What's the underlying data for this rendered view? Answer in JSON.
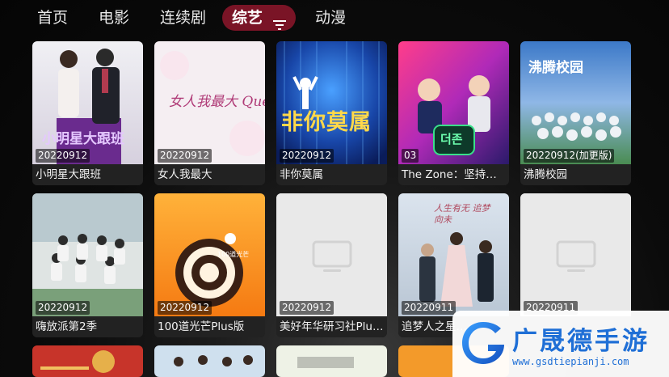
{
  "nav": {
    "tabs": [
      {
        "label": "首页",
        "active": false
      },
      {
        "label": "电影",
        "active": false
      },
      {
        "label": "连续剧",
        "active": false
      },
      {
        "label": "综艺",
        "active": true
      },
      {
        "label": "动漫",
        "active": false
      }
    ]
  },
  "cards": [
    {
      "badge": "20220912",
      "title": "小明星大跟班",
      "poster_text": "小明星大跟班"
    },
    {
      "badge": "20220912",
      "title": "女人我最大",
      "poster_text": "女人我最大 Queen"
    },
    {
      "badge": "20220912",
      "title": "非你莫属",
      "poster_text": "非你莫属"
    },
    {
      "badge": "03",
      "title": "The Zone：坚持才…",
      "poster_text": "더존"
    },
    {
      "badge": "20220912(加更版)",
      "title": "沸腾校园",
      "poster_text": "沸腾校园"
    },
    {
      "badge": "20220912",
      "title": "嗨放派第2季",
      "poster_text": ""
    },
    {
      "badge": "20220912",
      "title": "100道光芒Plus版",
      "poster_text": "100道光芒"
    },
    {
      "badge": "20220912",
      "title": "美好年华研习社Plu…",
      "poster_text": ""
    },
    {
      "badge": "20220911",
      "title": "追梦人之星…",
      "poster_text": "人生有无 追梦向未"
    },
    {
      "badge": "20220911",
      "title": "",
      "poster_text": ""
    }
  ],
  "watermark": {
    "title": "广晟德手游",
    "url": "www.gsdtiepianji.com"
  },
  "colors": {
    "active_tab": "#7a1426",
    "watermark_blue": "#1f6fd6"
  }
}
